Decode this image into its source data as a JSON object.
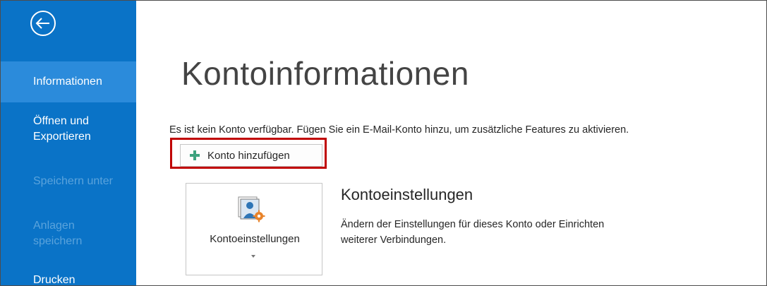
{
  "sidebar": {
    "items": [
      {
        "label": "Informationen",
        "state": "active"
      },
      {
        "label": "Öffnen und Exportieren",
        "state": "normal"
      },
      {
        "label": "Speichern unter",
        "state": "disabled"
      },
      {
        "label": "Anlagen speichern",
        "state": "disabled"
      },
      {
        "label": "Drucken",
        "state": "normal"
      }
    ],
    "back_icon": "back-arrow-circle-icon"
  },
  "main": {
    "title": "Kontoinformationen",
    "info_text": "Es ist kein Konto verfügbar. Fügen Sie ein E-Mail-Konto hinzu, um zusätzliche Features zu aktivieren.",
    "add_account_button": "Konto hinzufügen",
    "account_settings": {
      "tile_label": "Kontoeinstellungen",
      "heading": "Kontoeinstellungen",
      "description": "Ändern der Einstellungen für dieses Konto oder Einrichten weiterer Verbindungen."
    }
  },
  "colors": {
    "sidebar": "#0a73c7",
    "sidebar_active": "#2b8bdb",
    "highlight": "#c00000",
    "plus_icon": "#3ea37f"
  }
}
